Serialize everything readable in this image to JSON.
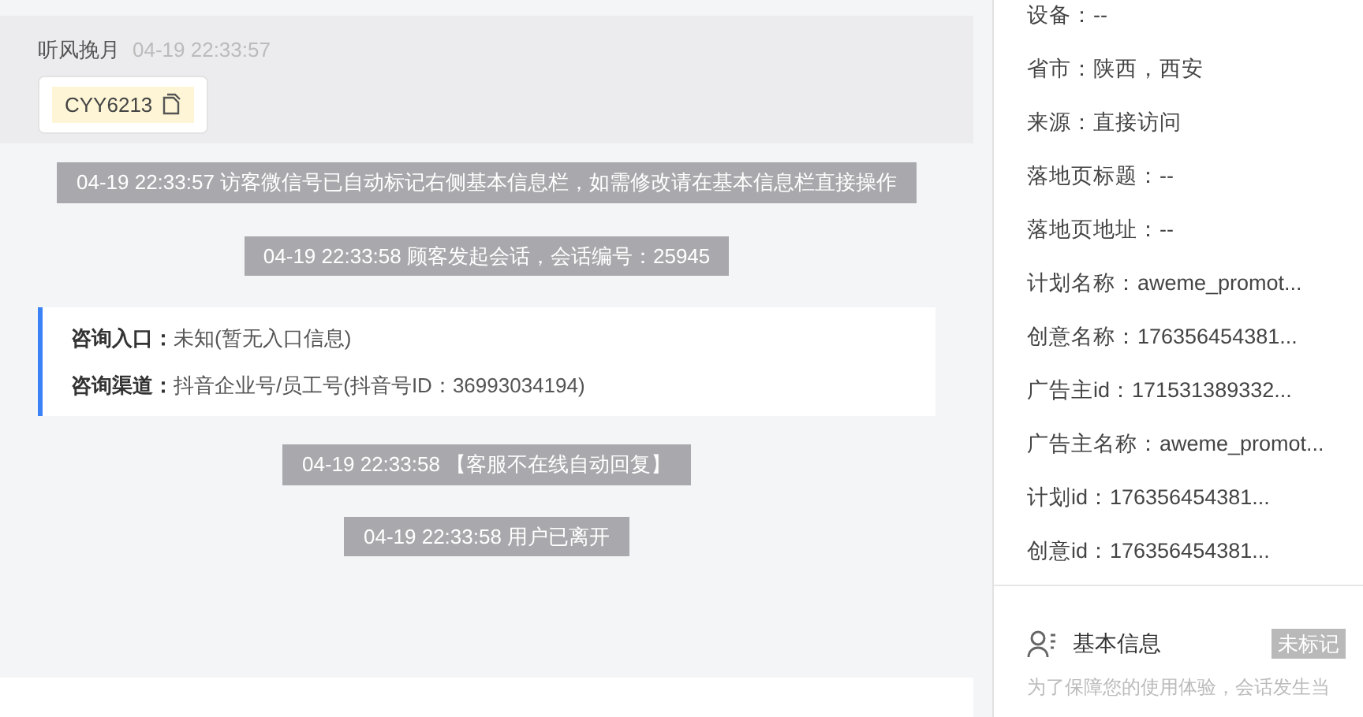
{
  "message": {
    "sender": "听风挽月",
    "time": "04-19 22:33:57",
    "code": "CYY6213"
  },
  "system_notes": [
    {
      "text": "04-19 22:33:57 访客微信号已自动标记右侧基本信息栏，如需修改请在基本信息栏直接操作"
    },
    {
      "text": "04-19 22:33:58 顾客发起会话，会话编号：25945"
    }
  ],
  "consult_card": [
    {
      "label": "咨询入口：",
      "value": "未知(暂无入口信息)"
    },
    {
      "label": "咨询渠道：",
      "value": "抖音企业号/员工号(抖音号ID：36993034194)"
    }
  ],
  "system_notes_after": [
    {
      "text": "04-19 22:33:58 【客服不在线自动回复】"
    },
    {
      "text": "04-19 22:33:58 用户已离开"
    }
  ],
  "visitor_info": [
    "设备：--",
    "省市：陕西，西安",
    "来源：直接访问",
    "落地页标题：--",
    "落地页地址：--",
    "计划名称：aweme_promot...",
    "创意名称：176356454381...",
    "广告主id：171531389332...",
    "广告主名称：aweme_promot...",
    "计划id：176356454381...",
    "创意id：176356454381..."
  ],
  "basic_info": {
    "title": "基本信息",
    "badge": "未标记",
    "note": "为了保障您的使用体验，会话发生当"
  }
}
